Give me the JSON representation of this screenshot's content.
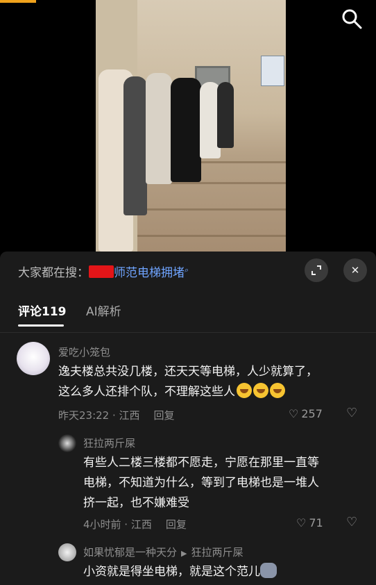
{
  "header": {
    "search_icon": "search-icon"
  },
  "panel": {
    "suggestion_prefix": "大家都在搜：",
    "suggestion_term": "师范电梯拥堵",
    "expand_icon": "expand-icon",
    "close_icon": "close-icon"
  },
  "tabs": [
    {
      "label": "评论119",
      "active": true
    },
    {
      "label": "AI解析",
      "active": false
    }
  ],
  "comments": [
    {
      "user": "爱吃小笼包",
      "lines": [
        "逸夫楼总共没几楼，还天天等电梯，人少就算了，",
        "这么多人还排个队，不理解这些人"
      ],
      "meta": "昨天23:22 · 江西",
      "reply_label": "回复",
      "likes": "257"
    },
    {
      "user": "狂拉两斤屎",
      "lines": [
        "有些人二楼三楼都不愿走，宁愿在那里一直等",
        "电梯，不知道为什么，等到了电梯也是一堆人",
        "挤一起，也不嫌难受"
      ],
      "meta": "4小时前 · 江西",
      "reply_label": "回复",
      "likes": "71"
    },
    {
      "user": "如果忧郁是一种天分",
      "reply_to": "狂拉两斤屎",
      "lines": [
        "小资就是得坐电梯，就是这个范儿"
      ]
    }
  ]
}
